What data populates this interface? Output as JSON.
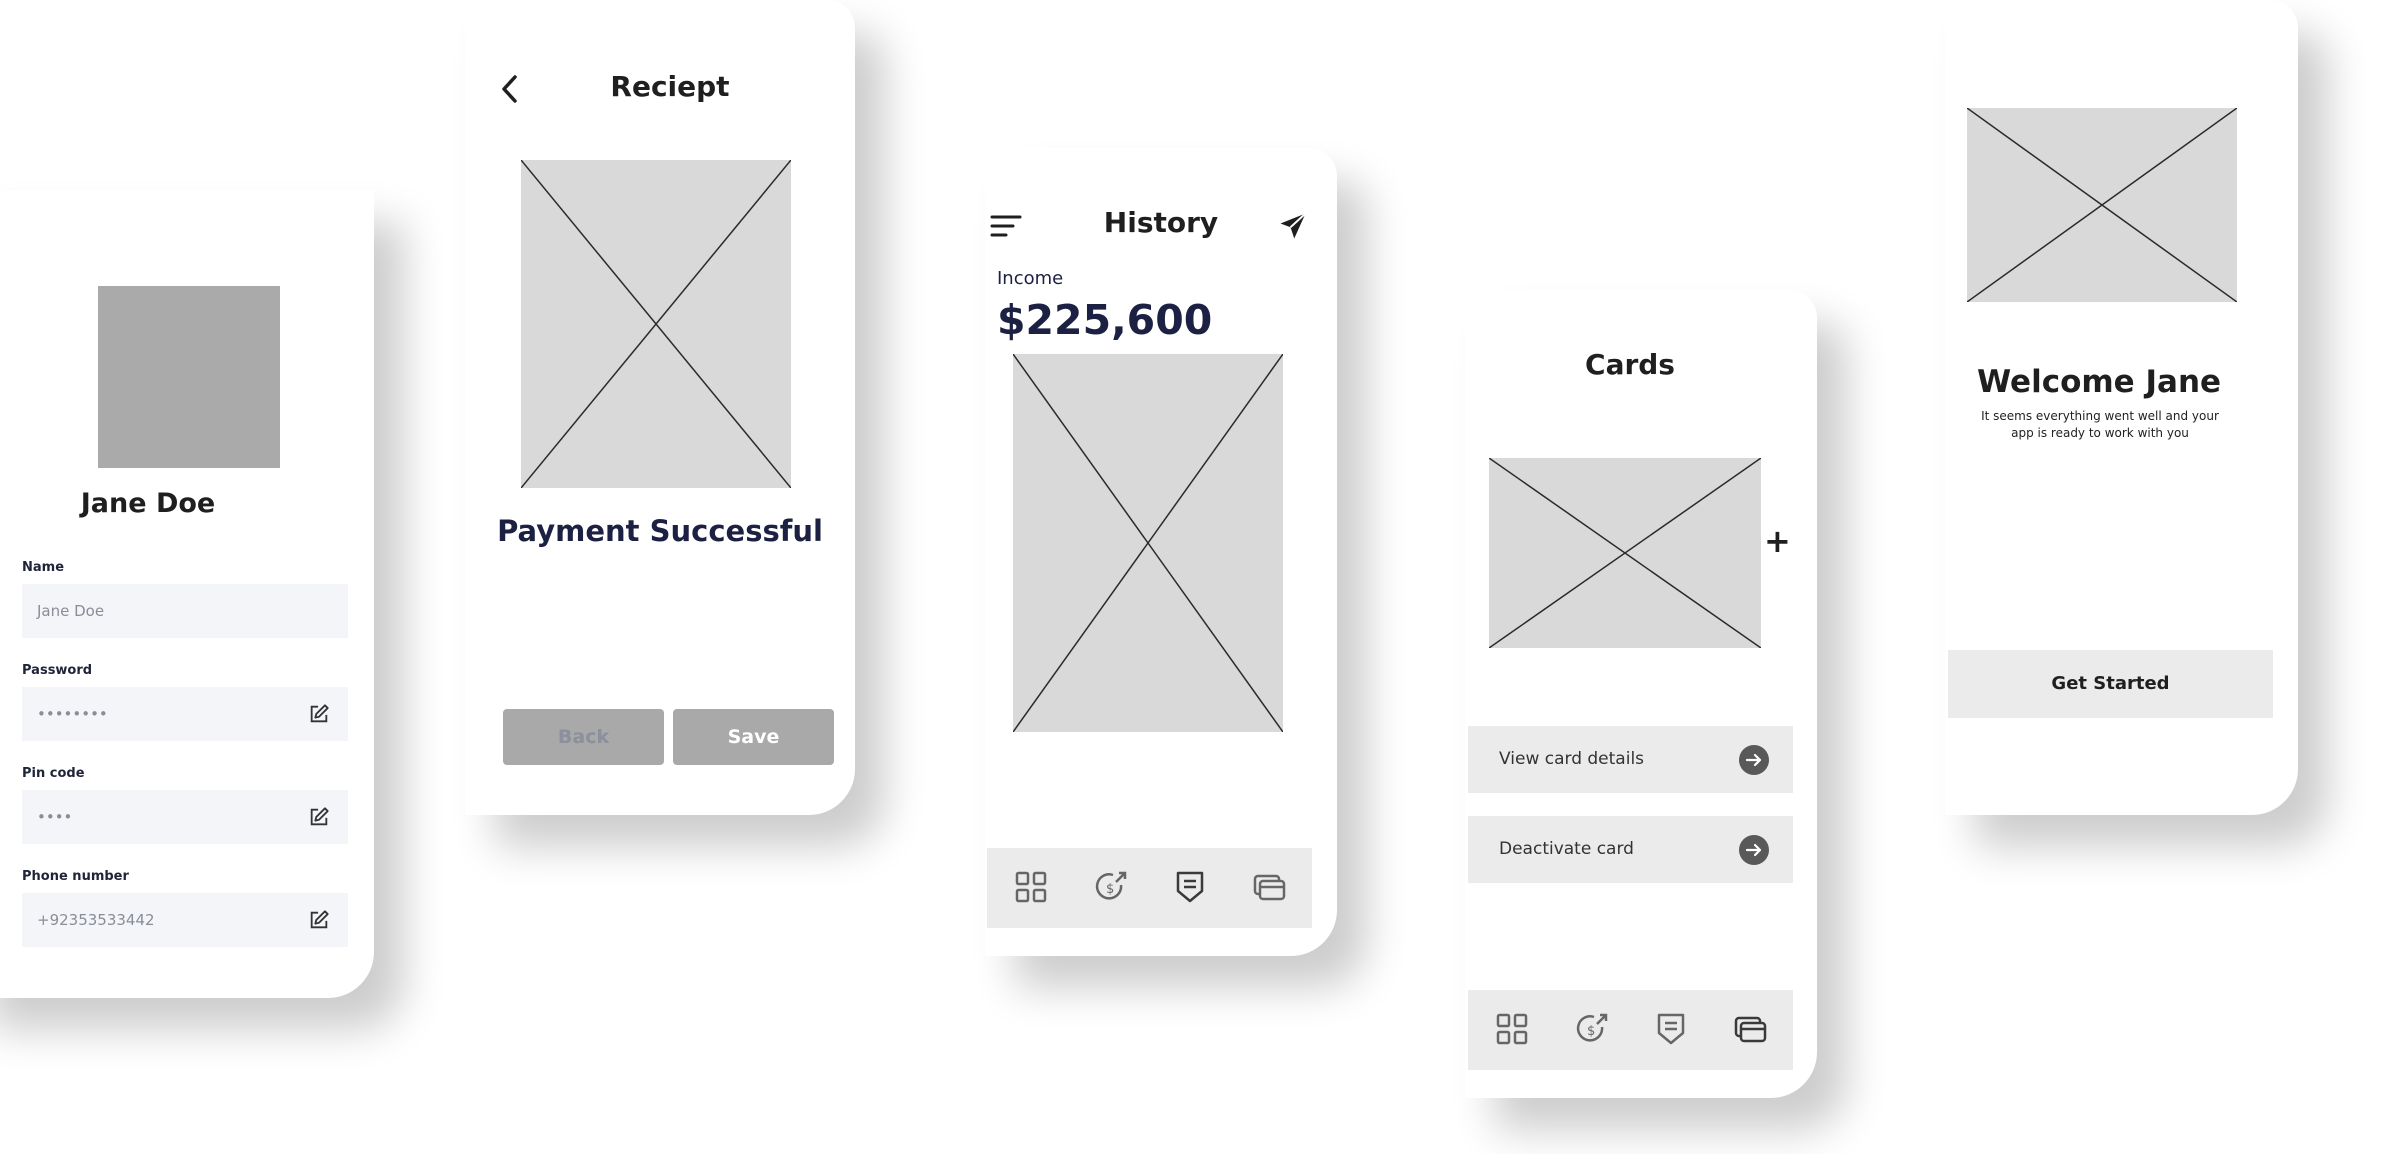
{
  "profile": {
    "name": "Jane Doe",
    "fields": [
      {
        "label": "Name",
        "value": "Jane Doe",
        "editable": false
      },
      {
        "label": "Password",
        "value": "••••••••",
        "editable": true
      },
      {
        "label": "Pin code",
        "value": "••••",
        "editable": true
      },
      {
        "label": "Phone number",
        "value": "+92353533442",
        "editable": true
      }
    ]
  },
  "receipt": {
    "title": "Reciept",
    "status": "Payment Successful",
    "back_label": "Back",
    "save_label": "Save"
  },
  "history": {
    "title": "History",
    "income_label": "Income",
    "income_amount": "$225,600"
  },
  "cards": {
    "title": "Cards",
    "add_label": "+",
    "actions": [
      "View card details",
      "Deactivate card"
    ]
  },
  "welcome": {
    "title": "Welcome Jane",
    "subtitle": "It seems everything went well and your app is ready to work with you",
    "cta_label": "Get Started"
  },
  "tabbar_icons": [
    "grid-icon",
    "money-transfer-icon",
    "receipt-icon",
    "cards-icon"
  ],
  "colors": {
    "navy_text": "#1c2042",
    "placeholder": "#d9d9d9",
    "avatar": "#aaaaaa",
    "field_bg": "#f4f5f8",
    "button_grey": "#a9a9a9",
    "panel_grey": "#ebebeb",
    "arrow_dark": "#595959"
  }
}
